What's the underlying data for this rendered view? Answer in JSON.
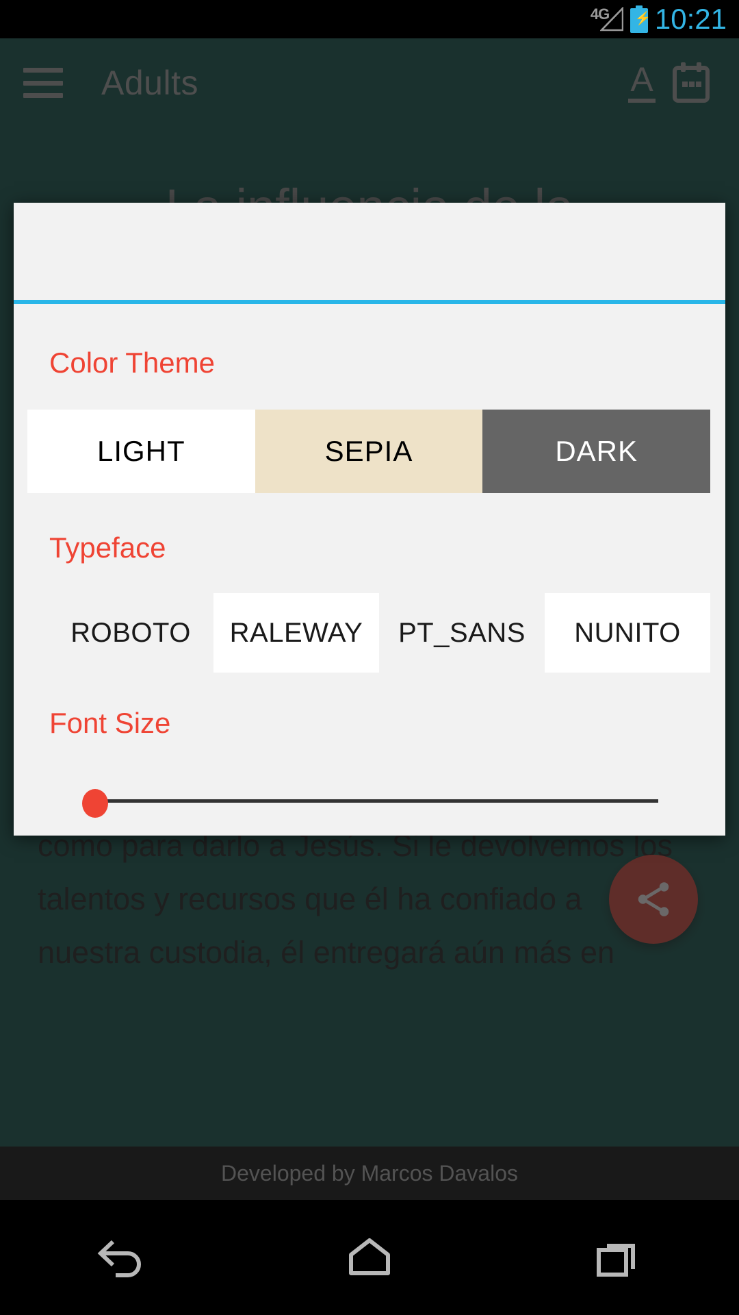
{
  "status_bar": {
    "network": "4G",
    "network_icon": "signal-triangle-icon",
    "battery_icon": "battery-charging-icon",
    "time": "10:21",
    "time_color": "#33b5e5"
  },
  "appbar": {
    "menu_icon": "hamburger-menu-icon",
    "title": "Adults",
    "format_icon": "format-text-a-icon",
    "calendar_icon": "calendar-icon",
    "background_color": "#044038"
  },
  "article": {
    "title": "La influencia de la",
    "body_lines": [
      "como para darlo a Jesús. Si le devolvemos los",
      "talentos y recursos que él ha confiado a",
      "nuestra custodia, él entregará aún más en"
    ]
  },
  "fab": {
    "icon": "share-icon",
    "color": "#b9352b"
  },
  "dialog": {
    "title": "",
    "title_placeholder": "",
    "accent_underline_color": "#29b6e8",
    "background_color": "#f2f2f2",
    "color_theme": {
      "label": "Color Theme",
      "label_color": "#ef4434",
      "options": [
        {
          "label": "LIGHT",
          "bg": "#ffffff",
          "fg": "#000000"
        },
        {
          "label": "SEPIA",
          "bg": "#eee2c8",
          "fg": "#000000"
        },
        {
          "label": "DARK",
          "bg": "#656565",
          "fg": "#ffffff"
        }
      ],
      "selected": "LIGHT"
    },
    "typeface": {
      "label": "Typeface",
      "label_color": "#ef4434",
      "options": [
        {
          "label": "ROBOTO",
          "selected": false
        },
        {
          "label": "RALEWAY",
          "selected": true
        },
        {
          "label": "PT_SANS",
          "selected": false
        },
        {
          "label": "NUNITO",
          "selected": true
        }
      ]
    },
    "font_size": {
      "label": "Font Size",
      "label_color": "#ef4434",
      "value": 0,
      "min": 0,
      "max": 100,
      "thumb_color": "#ef4434",
      "track_color": "#333333"
    }
  },
  "footer": {
    "credit": "Developed by Marcos Davalos"
  },
  "navbar": {
    "back_icon": "back-arrow-icon",
    "home_icon": "home-icon",
    "recents_icon": "recent-apps-icon"
  }
}
